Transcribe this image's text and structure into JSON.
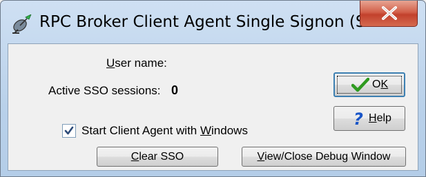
{
  "window": {
    "title": "RPC Broker Client Agent Single Signon (S..."
  },
  "fields": {
    "user_name_label_u": "U",
    "user_name_label_rest": "ser name:",
    "sessions_label": "Active SSO sessions:",
    "sessions_value": "0"
  },
  "options": {
    "start_with_windows_pre": "Start Client Agent with ",
    "start_with_windows_u": "W",
    "start_with_windows_post": "indows",
    "start_with_windows_checked": true
  },
  "buttons": {
    "ok_pre": "O",
    "ok_u": "K",
    "help_u": "H",
    "help_rest": "elp",
    "clear_u": "C",
    "clear_rest": "lear SSO",
    "debug_u": "V",
    "debug_rest": "iew/Close Debug Window"
  },
  "icons": {
    "app": "satellite-dish-icon",
    "close": "close-icon",
    "ok": "green-checkmark-icon",
    "help": "blue-question-mark-icon",
    "checkbox": "checkmark-icon"
  },
  "colors": {
    "close_button": "#c94a33",
    "ok_check": "#2e9a1f",
    "help_question": "#1a56c8"
  }
}
